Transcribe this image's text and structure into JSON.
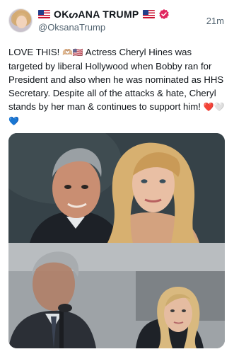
{
  "post": {
    "author": {
      "display_name": "OKᔕANA TRUMP",
      "handle": "@OksanaTrump",
      "flag_icon": "us-flag-icon",
      "verified_icon": "verified-badge-icon",
      "verified_color": "#e0245e"
    },
    "timestamp": "21m",
    "text_part1": "LOVE THIS! ",
    "text_emoji1": "🫶🏼🇺🇸",
    "text_part2": " Actress Cheryl Hines was targeted by liberal Hollywood when Bobby ran for President and also when he was nominated as HHS Secretary. Despite all of the attacks & hate, Cheryl stands by her man & continues to support him! ",
    "text_emoji2": "❤️🤍💙",
    "media": [
      {
        "type": "photo",
        "description_icon": "photo-couple-portrait"
      },
      {
        "type": "photo",
        "description_icon": "photo-hearing-room"
      }
    ]
  }
}
